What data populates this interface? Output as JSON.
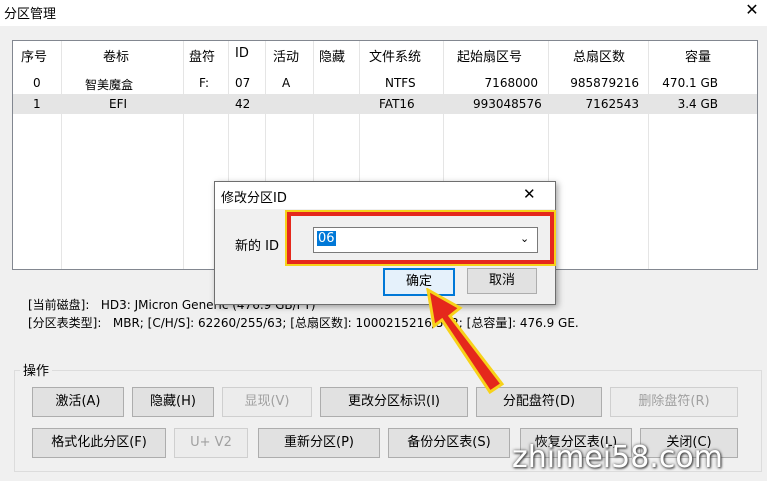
{
  "window": {
    "title": "分区管理"
  },
  "table": {
    "headers": [
      "序号",
      "卷标",
      "盘符",
      "ID",
      "活动",
      "隐藏",
      "文件系统",
      "起始扇区号",
      "总扇区数",
      "容量"
    ],
    "rows": [
      {
        "index": "0",
        "label": "智美魔盒",
        "drive": "F:",
        "id": "07",
        "active": "A",
        "hidden": "",
        "fs": "NTFS",
        "start": "7168000",
        "total": "985879216",
        "size": "470.1 GB"
      },
      {
        "index": "1",
        "label": "EFI",
        "drive": "",
        "id": "42",
        "active": "",
        "hidden": "",
        "fs": "FAT16",
        "start": "993048576",
        "total": "7162543",
        "size": "3.4 GB"
      }
    ]
  },
  "info": {
    "disk_label": "[当前磁盘]:",
    "disk_value": "HD3: JMicron Generic (476.9 GB/FY)",
    "type_label": "[分区表类型]:",
    "type_value": "MBR;      [C/H/S]: 62260/255/63; [总扇区数]: 1000215216/512; [总容量]: 476.9 GE."
  },
  "ops": {
    "group_label": "操作",
    "row1": [
      "激活(A)",
      "隐藏(H)",
      "显现(V)",
      "更改分区标识(I)",
      "分配盘符(D)",
      "删除盘符(R)"
    ],
    "row2": [
      "格式化此分区(F)",
      "U+ V2",
      "重新分区(P)",
      "备份分区表(S)",
      "恢复分区表(L)",
      "关闭(C)"
    ]
  },
  "dialog": {
    "title": "修改分区ID",
    "field_label": "新的 ID",
    "field_value": "06",
    "ok": "确定",
    "cancel": "取消"
  },
  "watermark": "zhimei58.com",
  "colors": {
    "highlight_red": "#e5281c",
    "highlight_yellow": "#f7d21a",
    "selection_blue": "#0078d7"
  }
}
